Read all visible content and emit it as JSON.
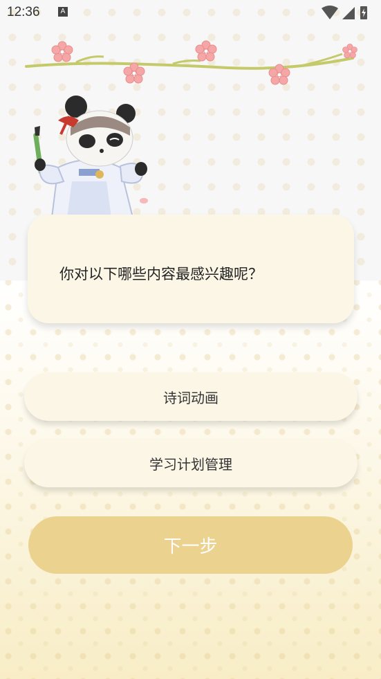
{
  "status_bar": {
    "time": "12:36",
    "notification_badge": "A",
    "icons": [
      "wifi-icon",
      "signal-icon",
      "battery-charging-icon"
    ]
  },
  "question": {
    "text": "你对以下哪些内容最感兴趣呢？"
  },
  "options": [
    {
      "label": "诗词动画"
    },
    {
      "label": "学习计划管理"
    }
  ],
  "actions": {
    "next_label": "下一步"
  },
  "colors": {
    "card_bg": "#fbf6e6",
    "next_button_bg": "#ebd28e",
    "blossom_pink": "#f5a6a6",
    "branch_green": "#c4c96a"
  }
}
